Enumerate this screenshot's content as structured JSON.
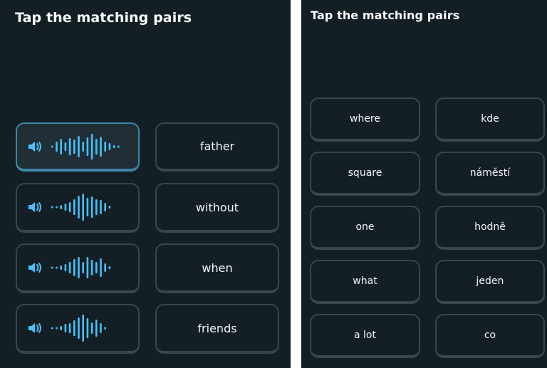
{
  "left": {
    "title": "Tap the matching pairs",
    "audio_items": [
      {
        "bars": [
          3,
          14,
          22,
          12,
          24,
          20,
          30,
          14,
          26,
          36,
          22,
          28,
          14,
          10,
          4,
          3
        ],
        "selected": true
      },
      {
        "bars": [
          3,
          3,
          6,
          10,
          14,
          22,
          32,
          38,
          26,
          30,
          22,
          20,
          12,
          4
        ],
        "selected": false
      },
      {
        "bars": [
          3,
          3,
          6,
          10,
          16,
          24,
          30,
          16,
          30,
          22,
          16,
          26,
          12,
          4
        ],
        "selected": false
      },
      {
        "bars": [
          3,
          3,
          6,
          12,
          14,
          22,
          30,
          38,
          28,
          16,
          24,
          14,
          4
        ],
        "selected": false
      }
    ],
    "words": [
      "father",
      "without",
      "when",
      "friends"
    ]
  },
  "right": {
    "title": "Tap the matching pairs",
    "english": [
      "where",
      "square",
      "one",
      "what",
      "a lot"
    ],
    "czech": [
      "kde",
      "náměstí",
      "hodně",
      "jeden",
      "co"
    ]
  },
  "colors": {
    "background": "#131f24",
    "tile_border": "#37464f",
    "selected_border": "#3f85a7",
    "selected_fill": "#202f36",
    "wave": "#49c0f8",
    "speaker": "#49c0f8",
    "text": "#f1f7fb"
  },
  "icons": {
    "speaker": "speaker-icon",
    "waveform": "waveform-icon"
  }
}
